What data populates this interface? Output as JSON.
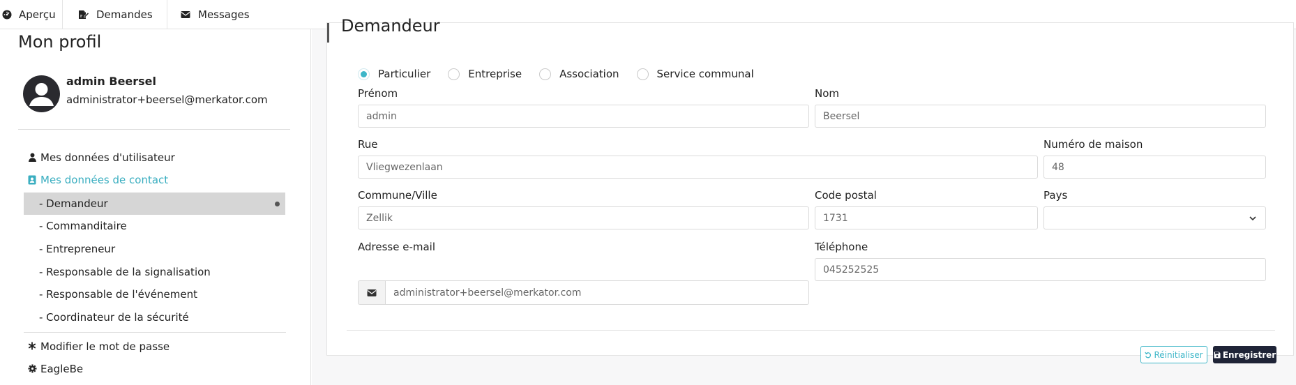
{
  "nav": {
    "items": [
      {
        "label": "Aperçu",
        "icon": "dashboard-icon"
      },
      {
        "label": "Demandes",
        "icon": "file-signature-icon"
      },
      {
        "label": "Messages",
        "icon": "envelope-icon"
      }
    ]
  },
  "sidebar": {
    "title": "Mon profil",
    "user_name": "admin Beersel",
    "user_email": "administrator+beersel@merkator.com",
    "links": {
      "user_data": "Mes données d'utilisateur",
      "contact_data": "Mes données de contact",
      "change_password": "Modifier le mot de passe",
      "eaglebe": "EagleBe"
    },
    "sub_items": [
      "- Demandeur",
      "- Commanditaire",
      "- Entrepreneur",
      "- Responsable de la signalisation",
      "- Responsable de l'événement",
      "- Coordinateur de la sécurité"
    ]
  },
  "form": {
    "title": "Demandeur",
    "types": [
      "Particulier",
      "Entreprise",
      "Association",
      "Service communal"
    ],
    "selected_type": "Particulier",
    "labels": {
      "prenom": "Prénom",
      "nom": "Nom",
      "rue": "Rue",
      "numero": "Numéro de maison",
      "commune": "Commune/Ville",
      "code_postal": "Code postal",
      "pays": "Pays",
      "email": "Adresse e-mail",
      "telephone": "Téléphone"
    },
    "values": {
      "prenom": "admin",
      "nom": "Beersel",
      "rue": "Vliegwezenlaan",
      "numero": "48",
      "commune": "Zellik",
      "code_postal": "1731",
      "pays": "",
      "email": "administrator+beersel@merkator.com",
      "telephone": "045252525"
    },
    "buttons": {
      "reset": "Réinitialiser",
      "save": "Enregistrer"
    }
  },
  "colors": {
    "accent": "#3db6c8",
    "dark_button": "#1f2437",
    "selected_row": "#d6d6d6"
  }
}
